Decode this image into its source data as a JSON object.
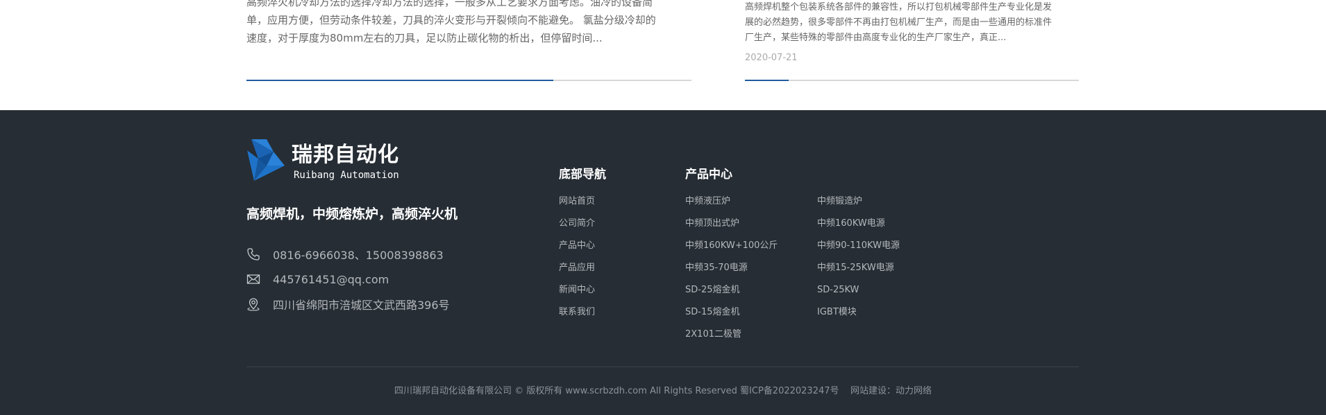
{
  "news": {
    "left_excerpt": "高频淬火机冷却方法的选择冷却方法的选择，一般多从工艺要求方面考虑。油冷的设备简\n单，应用方便，但劳动条件较差，刀具的淬火变形与开裂倾向不能避免。 氯盐分级冷却的\n速度，对于厚度为80mm左右的刀具，足以防止碳化物的析出，但停留时间...",
    "right_excerpt": "高频焊机整个包装系统各部件的兼容性，所以打包机械零部件生产专业化是发\n展的必然趋势，很多零部件不再由打包机械厂生产，而是由一些通用的标准件\n厂生产，某些特殊的零部件由高度专业化的生产厂家生产，真正...",
    "right_date": "2020-07-21",
    "left_progress": 0.69,
    "right_progress": 0.13,
    "accent_color": "#1f5a9e"
  },
  "footer": {
    "logo": {
      "cn": "瑞邦自动化",
      "en": "Ruibang Automation",
      "icon": "logo-triangle-icon",
      "color": "#1e73c8"
    },
    "slogan": "高频焊机，中频熔炼炉，高频淬火机",
    "contact": {
      "phone": "0816-6966038、15008398863",
      "email": "445761451@qq.com",
      "address": "四川省绵阳市涪城区文武西路396号"
    },
    "nav": {
      "title": "底部导航",
      "items": [
        "网站首页",
        "公司简介",
        "产品中心",
        "产品应用",
        "新闻中心",
        "联系我们"
      ]
    },
    "products": {
      "title": "产品中心",
      "col1": [
        "中频液压炉",
        "中频顶出式炉",
        "中频160KW+100公斤",
        "中频35-70电源",
        "SD-25熔金机",
        "SD-15熔金机",
        "2X101二极管"
      ],
      "col2": [
        "中频锻造炉",
        "中频160KW电源",
        "中频90-110KW电源",
        "中频15-25KW电源",
        "SD-25KW",
        "IGBT模块"
      ]
    },
    "copyright": "四川瑞邦自动化设备有限公司 © 版权所有 www.scrbzdh.com All Rights Reserved 蜀ICP备2022023247号    网站建设：动力网络",
    "background_color": "#262d34"
  }
}
